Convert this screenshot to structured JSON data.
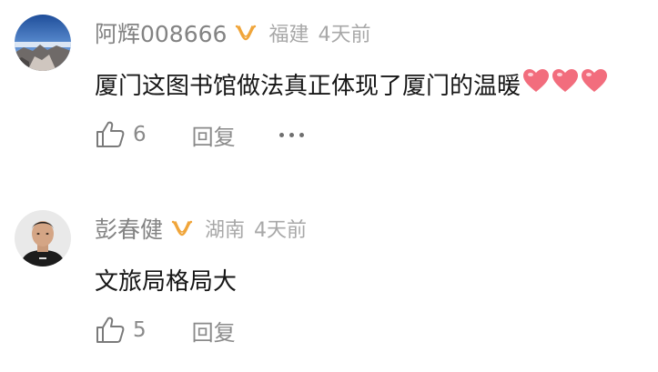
{
  "comments": [
    {
      "username": "阿辉008666",
      "badge_icon": "vip-badge-icon",
      "badge_color": "#f0a53a",
      "location": "福建",
      "time": "4天前",
      "text": "厦门这图书馆做法真正体现了厦门的温暖",
      "emoji": [
        "heart",
        "heart",
        "heart"
      ],
      "emoji_color": "#f26d7d",
      "likes": "6",
      "reply_label": "回复",
      "has_more_menu": true
    },
    {
      "username": "彭春健",
      "badge_icon": "vip-badge-icon",
      "badge_color": "#f0a53a",
      "location": "湖南",
      "time": "4天前",
      "text": "文旅局格局大",
      "likes": "5",
      "reply_label": "回复",
      "has_more_menu": false
    }
  ]
}
